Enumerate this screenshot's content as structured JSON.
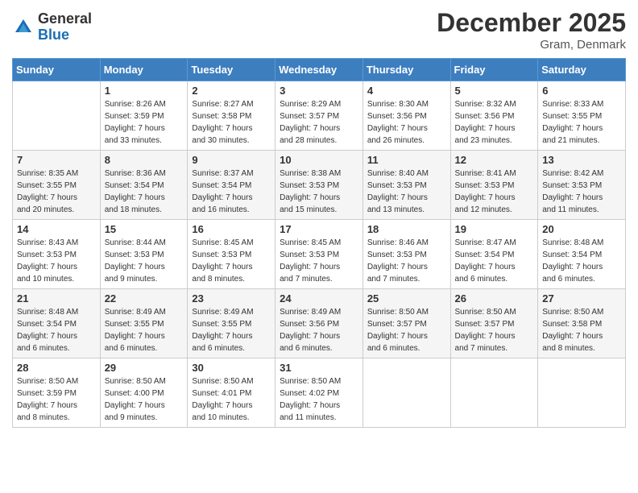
{
  "logo": {
    "general": "General",
    "blue": "Blue"
  },
  "title": "December 2025",
  "location": "Gram, Denmark",
  "days_header": [
    "Sunday",
    "Monday",
    "Tuesday",
    "Wednesday",
    "Thursday",
    "Friday",
    "Saturday"
  ],
  "weeks": [
    [
      {
        "day": "",
        "info": ""
      },
      {
        "day": "1",
        "info": "Sunrise: 8:26 AM\nSunset: 3:59 PM\nDaylight: 7 hours\nand 33 minutes."
      },
      {
        "day": "2",
        "info": "Sunrise: 8:27 AM\nSunset: 3:58 PM\nDaylight: 7 hours\nand 30 minutes."
      },
      {
        "day": "3",
        "info": "Sunrise: 8:29 AM\nSunset: 3:57 PM\nDaylight: 7 hours\nand 28 minutes."
      },
      {
        "day": "4",
        "info": "Sunrise: 8:30 AM\nSunset: 3:56 PM\nDaylight: 7 hours\nand 26 minutes."
      },
      {
        "day": "5",
        "info": "Sunrise: 8:32 AM\nSunset: 3:56 PM\nDaylight: 7 hours\nand 23 minutes."
      },
      {
        "day": "6",
        "info": "Sunrise: 8:33 AM\nSunset: 3:55 PM\nDaylight: 7 hours\nand 21 minutes."
      }
    ],
    [
      {
        "day": "7",
        "info": "Sunrise: 8:35 AM\nSunset: 3:55 PM\nDaylight: 7 hours\nand 20 minutes."
      },
      {
        "day": "8",
        "info": "Sunrise: 8:36 AM\nSunset: 3:54 PM\nDaylight: 7 hours\nand 18 minutes."
      },
      {
        "day": "9",
        "info": "Sunrise: 8:37 AM\nSunset: 3:54 PM\nDaylight: 7 hours\nand 16 minutes."
      },
      {
        "day": "10",
        "info": "Sunrise: 8:38 AM\nSunset: 3:53 PM\nDaylight: 7 hours\nand 15 minutes."
      },
      {
        "day": "11",
        "info": "Sunrise: 8:40 AM\nSunset: 3:53 PM\nDaylight: 7 hours\nand 13 minutes."
      },
      {
        "day": "12",
        "info": "Sunrise: 8:41 AM\nSunset: 3:53 PM\nDaylight: 7 hours\nand 12 minutes."
      },
      {
        "day": "13",
        "info": "Sunrise: 8:42 AM\nSunset: 3:53 PM\nDaylight: 7 hours\nand 11 minutes."
      }
    ],
    [
      {
        "day": "14",
        "info": "Sunrise: 8:43 AM\nSunset: 3:53 PM\nDaylight: 7 hours\nand 10 minutes."
      },
      {
        "day": "15",
        "info": "Sunrise: 8:44 AM\nSunset: 3:53 PM\nDaylight: 7 hours\nand 9 minutes."
      },
      {
        "day": "16",
        "info": "Sunrise: 8:45 AM\nSunset: 3:53 PM\nDaylight: 7 hours\nand 8 minutes."
      },
      {
        "day": "17",
        "info": "Sunrise: 8:45 AM\nSunset: 3:53 PM\nDaylight: 7 hours\nand 7 minutes."
      },
      {
        "day": "18",
        "info": "Sunrise: 8:46 AM\nSunset: 3:53 PM\nDaylight: 7 hours\nand 7 minutes."
      },
      {
        "day": "19",
        "info": "Sunrise: 8:47 AM\nSunset: 3:54 PM\nDaylight: 7 hours\nand 6 minutes."
      },
      {
        "day": "20",
        "info": "Sunrise: 8:48 AM\nSunset: 3:54 PM\nDaylight: 7 hours\nand 6 minutes."
      }
    ],
    [
      {
        "day": "21",
        "info": "Sunrise: 8:48 AM\nSunset: 3:54 PM\nDaylight: 7 hours\nand 6 minutes."
      },
      {
        "day": "22",
        "info": "Sunrise: 8:49 AM\nSunset: 3:55 PM\nDaylight: 7 hours\nand 6 minutes."
      },
      {
        "day": "23",
        "info": "Sunrise: 8:49 AM\nSunset: 3:55 PM\nDaylight: 7 hours\nand 6 minutes."
      },
      {
        "day": "24",
        "info": "Sunrise: 8:49 AM\nSunset: 3:56 PM\nDaylight: 7 hours\nand 6 minutes."
      },
      {
        "day": "25",
        "info": "Sunrise: 8:50 AM\nSunset: 3:57 PM\nDaylight: 7 hours\nand 6 minutes."
      },
      {
        "day": "26",
        "info": "Sunrise: 8:50 AM\nSunset: 3:57 PM\nDaylight: 7 hours\nand 7 minutes."
      },
      {
        "day": "27",
        "info": "Sunrise: 8:50 AM\nSunset: 3:58 PM\nDaylight: 7 hours\nand 8 minutes."
      }
    ],
    [
      {
        "day": "28",
        "info": "Sunrise: 8:50 AM\nSunset: 3:59 PM\nDaylight: 7 hours\nand 8 minutes."
      },
      {
        "day": "29",
        "info": "Sunrise: 8:50 AM\nSunset: 4:00 PM\nDaylight: 7 hours\nand 9 minutes."
      },
      {
        "day": "30",
        "info": "Sunrise: 8:50 AM\nSunset: 4:01 PM\nDaylight: 7 hours\nand 10 minutes."
      },
      {
        "day": "31",
        "info": "Sunrise: 8:50 AM\nSunset: 4:02 PM\nDaylight: 7 hours\nand 11 minutes."
      },
      {
        "day": "",
        "info": ""
      },
      {
        "day": "",
        "info": ""
      },
      {
        "day": "",
        "info": ""
      }
    ]
  ]
}
